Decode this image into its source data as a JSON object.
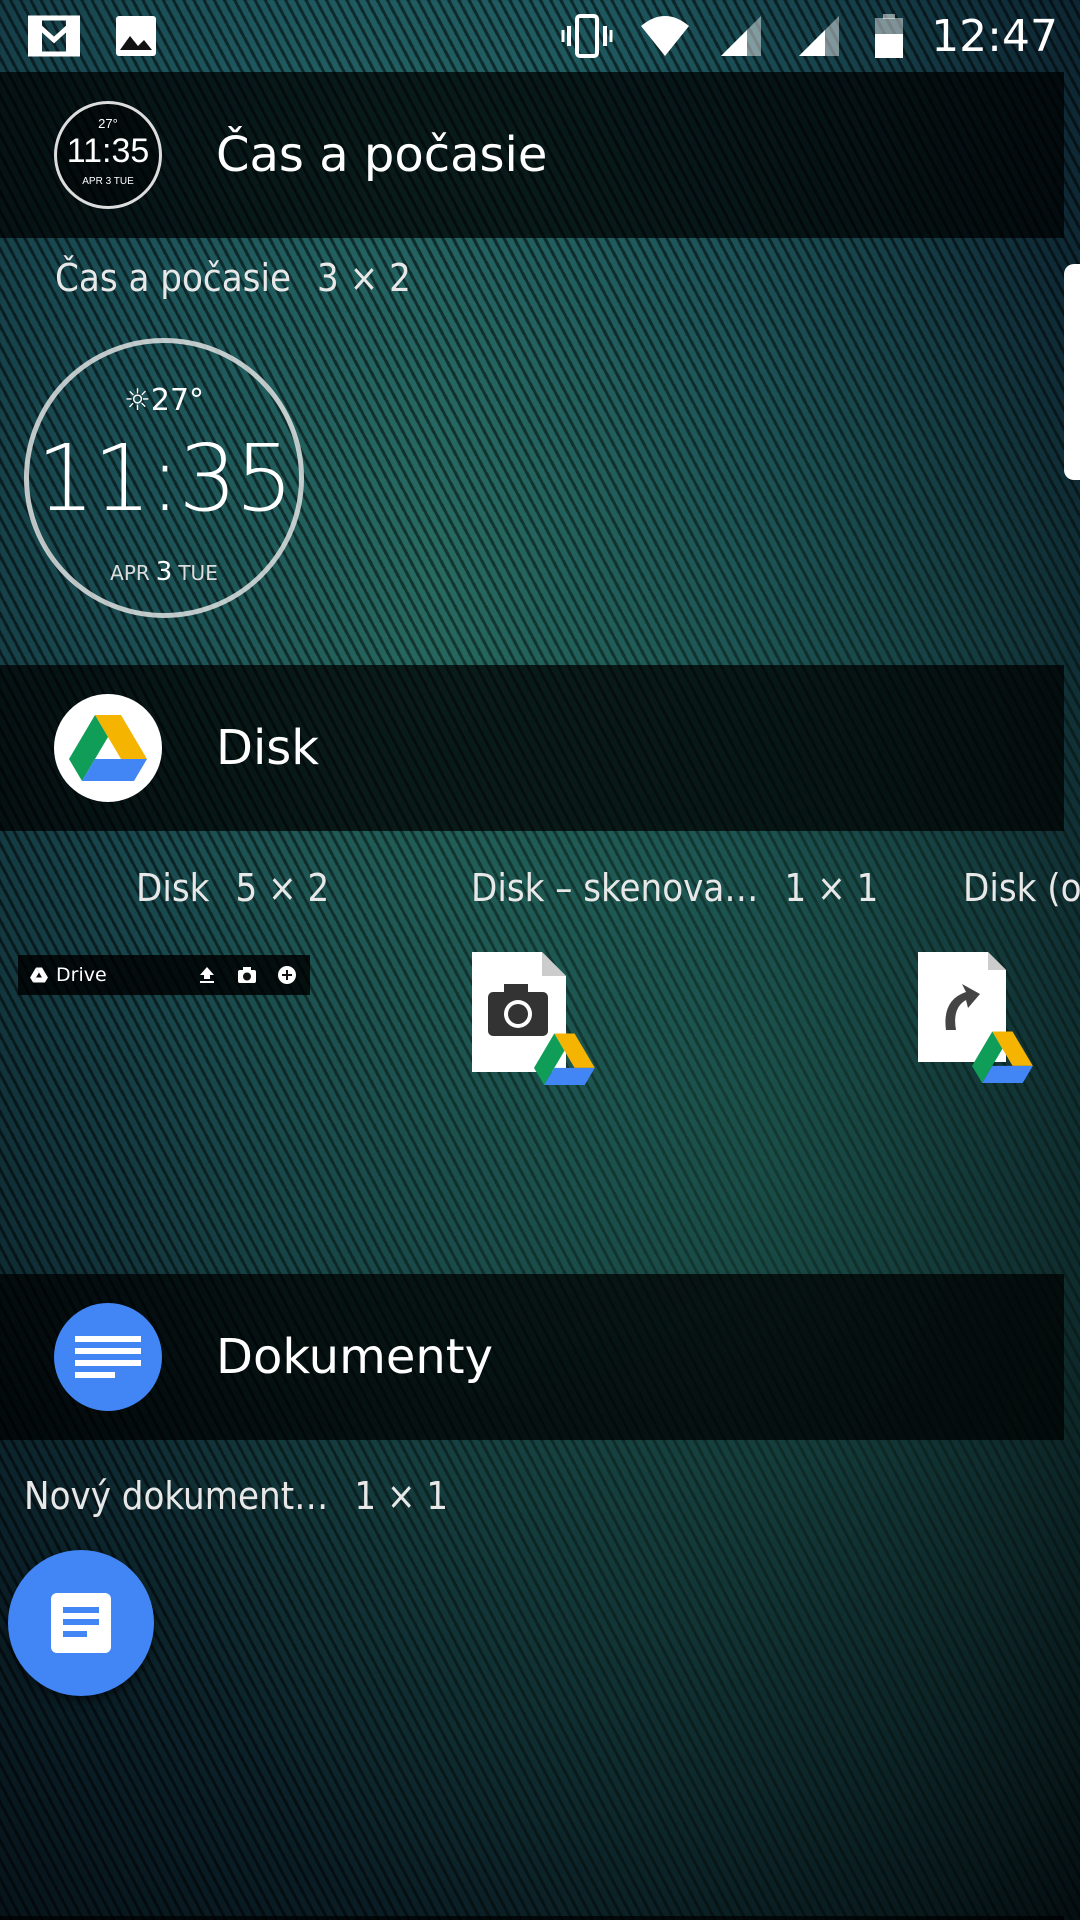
{
  "status_bar": {
    "time": "12:47",
    "left_icons": [
      "gmail-icon",
      "gallery-icon"
    ],
    "right_icons": [
      "vibrate-icon",
      "wifi-icon",
      "signal-icon",
      "signal-icon",
      "battery-icon"
    ]
  },
  "sections": [
    {
      "app": "Čas a počasie",
      "icon": "clock-weather-icon",
      "widgets": [
        {
          "label": "Čas a počasie",
          "dims": "3 × 2"
        }
      ]
    },
    {
      "app": "Disk",
      "icon": "google-drive-icon",
      "widgets": [
        {
          "label": "Disk",
          "dims": "5 × 2"
        },
        {
          "label": "Disk – skenova…",
          "dims": "1 × 1"
        },
        {
          "label": "Disk (o",
          "dims": ""
        }
      ]
    },
    {
      "app": "Dokumenty",
      "icon": "google-docs-icon",
      "widgets": [
        {
          "label": "Nový dokument…",
          "dims": "1 × 1"
        }
      ]
    }
  ],
  "clock_widget": {
    "temperature": "27°",
    "time": "11:35",
    "month": "APR",
    "day": "3",
    "weekday": "TUE"
  },
  "clock_header_icon": {
    "temperature": "27°",
    "time": "11:35",
    "date": "APR 3 TUE"
  },
  "drive_widget": {
    "title": "Drive"
  },
  "colors": {
    "docs_blue": "#4285f4",
    "drive_green": "#0f9d58",
    "drive_yellow": "#f4b400",
    "drive_blue": "#4285f4"
  }
}
